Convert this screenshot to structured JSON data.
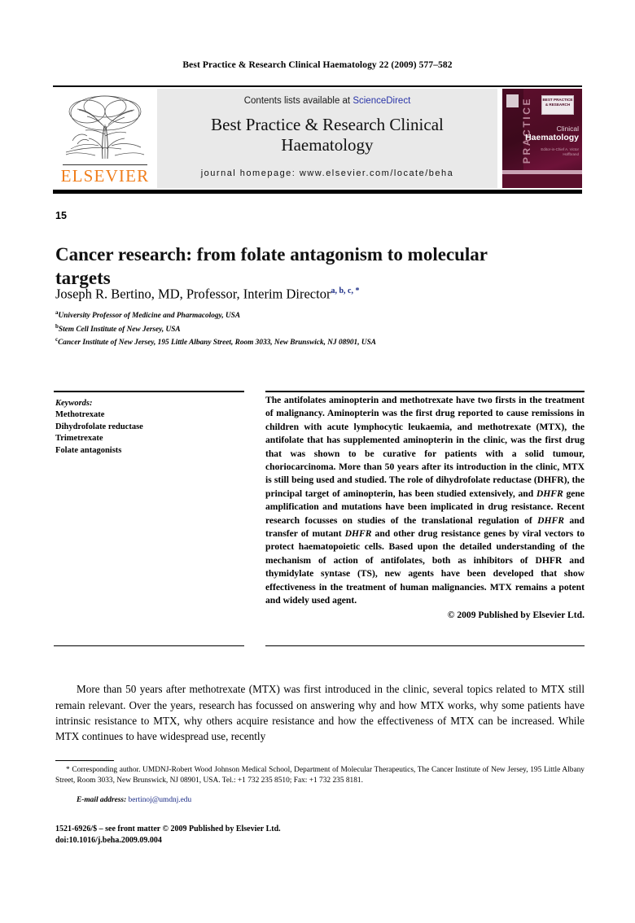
{
  "running_head": "Best Practice & Research Clinical Haematology 22 (2009) 577–582",
  "masthead": {
    "contents_prefix": "Contents lists available at ",
    "sciencedirect": "ScienceDirect",
    "journal_name": "Best Practice & Research Clinical Haematology",
    "journal_homepage": "journal homepage: www.elsevier.com/locate/beha",
    "publisher_wordmark": "ELSEVIER",
    "publisher_logo_icon": "elsevier-tree-logo",
    "accent_orange": "#f07d1a",
    "link_blue": "#2a35a8",
    "box_background": "#e9e9e9"
  },
  "cover": {
    "vertical_word": "PRACTICE",
    "badge_text": "BEST PRACTICE & RESEARCH",
    "title_line1": "Clinical",
    "title_line2": "Haematology",
    "editor_line": "Editor-in-Chief\nA. Victor Hoffbrand",
    "background_color": "#4d0c24",
    "band_color": "#c9a2b4"
  },
  "article": {
    "number": "15",
    "title": "Cancer research: from folate antagonism to molecular targets",
    "author": "Joseph R. Bertino, MD, Professor, Interim Director",
    "author_marks": "a, b, c, *",
    "affiliations": [
      {
        "mark": "a",
        "text": "University Professor of Medicine and Pharmacology, USA"
      },
      {
        "mark": "b",
        "text": "Stem Cell Institute of New Jersey, USA"
      },
      {
        "mark": "c",
        "text": "Cancer Institute of New Jersey, 195 Little Albany Street, Room 3033, New Brunswick, NJ 08901, USA"
      }
    ]
  },
  "keywords": {
    "heading": "Keywords:",
    "items": [
      "Methotrexate",
      "Dihydrofolate reductase",
      "Trimetrexate",
      "Folate antagonists"
    ]
  },
  "abstract": {
    "text_part_1": "The antifolates aminopterin and methotrexate have two firsts in the treatment of malignancy. Aminopterin was the first drug reported to cause remissions in children with acute lymphocytic leukaemia, and methotrexate (MTX), the antifolate that has supplemented aminopterin in the clinic, was the first drug that was shown to be curative for patients with a solid tumour, choriocarcinoma. More than 50 years after its introduction in the clinic, MTX is still being used and studied. The role of dihydrofolate reductase (DHFR), the principal target of aminopterin, has been studied extensively, and ",
    "italic_1": "DHFR",
    "text_part_2": " gene amplification and mutations have been implicated in drug resistance. Recent research focusses on studies of the translational regulation of ",
    "italic_2": "DHFR",
    "text_part_3": " and transfer of mutant ",
    "italic_3": "DHFR",
    "text_part_4": " and other drug resistance genes by viral vectors to protect haematopoietic cells. Based upon the detailed understanding of the mechanism of action of antifolates, both as inhibitors of DHFR and thymidylate syntase (TS), new agents have been developed that show effectiveness in the treatment of human malignancies. MTX remains a potent and widely used agent.",
    "copyright": "© 2009 Published by Elsevier Ltd."
  },
  "body": {
    "paragraph_1": "More than 50 years after methotrexate (MTX) was first introduced in the clinic, several topics related to MTX still remain relevant. Over the years, research has focussed on answering why and how MTX works, why some patients have intrinsic resistance to MTX, why others acquire resistance and how the effectiveness of MTX can be increased. While MTX continues to have widespread use, recently"
  },
  "footnotes": {
    "corresponding": "* Corresponding author. UMDNJ-Robert Wood Johnson Medical School, Department of Molecular Therapeutics, The Cancer Institute of New Jersey, 195 Little Albany Street, Room 3033, New Brunswick, NJ 08901, USA. Tel.: +1 732 235 8510; Fax: +1 732 235 8181.",
    "email_label": "E-mail address:",
    "email_address": "bertinoj@umdnj.edu",
    "frontmatter": "1521-6926/$ – see front matter © 2009 Published by Elsevier Ltd.",
    "doi": "doi:10.1016/j.beha.2009.09.004"
  }
}
